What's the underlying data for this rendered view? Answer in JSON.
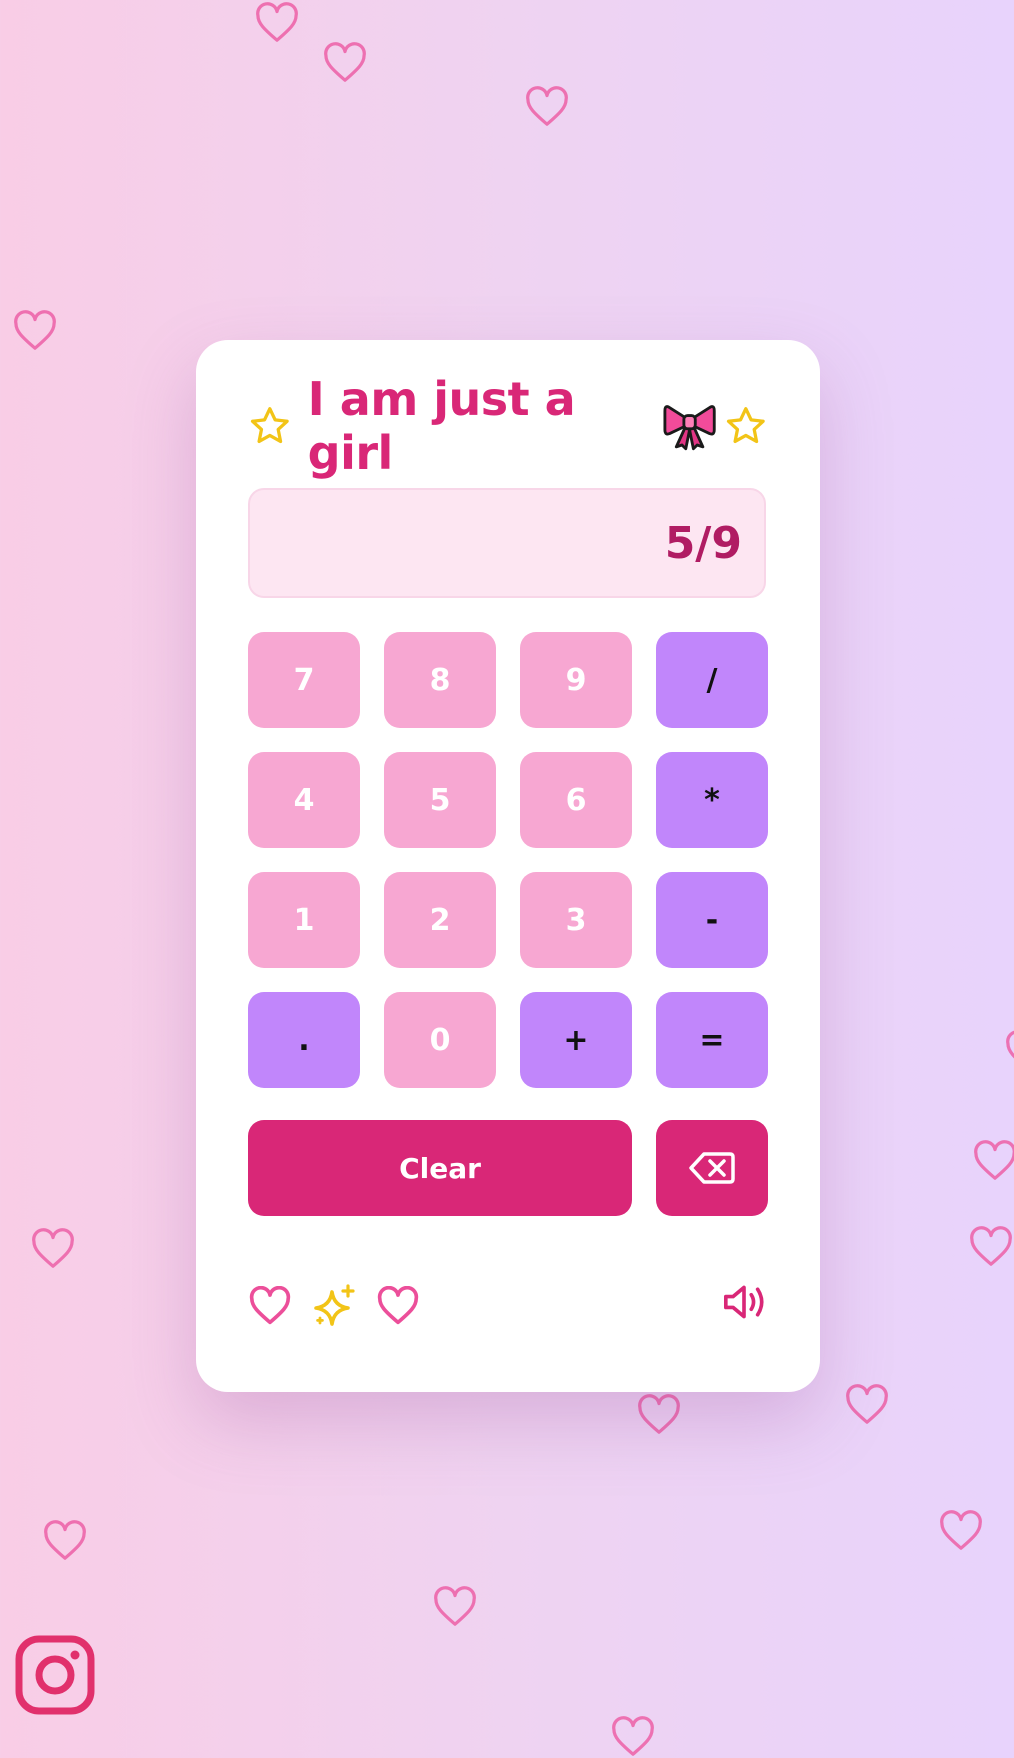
{
  "header": {
    "title": "I am just a girl",
    "title_color": "#d92777",
    "leading_icon": "star-icon",
    "trailing_icon": "star-icon",
    "emoji_icon": "ribbon-bow-icon"
  },
  "display": {
    "value": "5/9"
  },
  "keypad": {
    "keys": [
      "7",
      "8",
      "9",
      "/",
      "4",
      "5",
      "6",
      "*",
      "1",
      "2",
      "3",
      "-",
      ".",
      "0",
      "+",
      "="
    ],
    "number_color": "#f7a7d2",
    "operator_color": "#c186fb"
  },
  "actions": {
    "clear_label": "Clear",
    "backspace_icon": "backspace-icon",
    "accent_color": "#d92777"
  },
  "footer": {
    "icons": [
      "heart-icon",
      "sparkles-icon",
      "heart-icon",
      "volume-icon"
    ]
  },
  "social": {
    "icon": "instagram-icon"
  },
  "background": {
    "gradient": [
      "#f9cde6",
      "#e8d3fc"
    ],
    "decoration": "heart-icon"
  }
}
